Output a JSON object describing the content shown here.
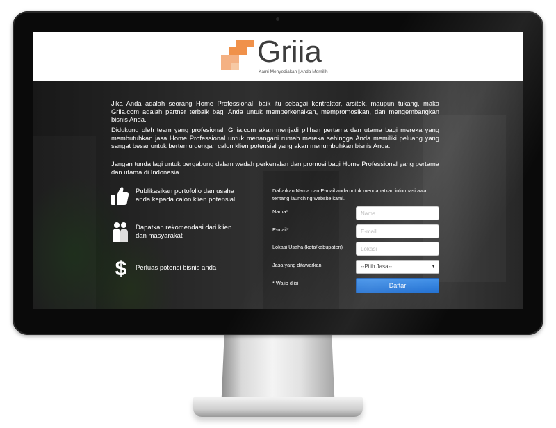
{
  "brand": {
    "name": "Griia",
    "tagline": "Kami Menyediakan | Anda Memilih",
    "logo_colors": [
      "#f0914a",
      "#f4b183"
    ]
  },
  "intro": {
    "paragraphs": [
      "Jika Anda adalah seorang Home Professional, baik itu sebagai kontraktor, arsitek, maupun tukang, maka Griia.com adalah partner terbaik bagi Anda untuk memperkenalkan, mempromosikan, dan mengembangkan bisnis Anda.",
      "Didukung oleh team yang profesional, Griia.com akan menjadi pilihan pertama dan utama bagi mereka yang membutuhkan jasa Home Professional untuk menangani rumah mereka sehingga Anda memiliki peluang yang sangat besar untuk bertemu dengan calon klien potensial yang akan menumbuhkan bisnis Anda.",
      "Jangan tunda lagi untuk bergabung dalam wadah perkenalan dan promosi bagi Home Professional yang pertama dan utama di Indonesia."
    ]
  },
  "features": [
    {
      "icon": "thumbs-up-icon",
      "text": "Publikasikan portofolio dan usaha anda kepada calon klien potensial"
    },
    {
      "icon": "people-icon",
      "text": "Dapatkan rekomendasi dari klien dan masyarakat"
    },
    {
      "icon": "dollar-icon",
      "text": "Perluas potensi bisnis anda"
    }
  ],
  "form": {
    "intro": "Daftarkan Nama dan E-mail anda untuk mendapatkan informasi awal tentang launching website kami.",
    "name_label": "Nama*",
    "name_placeholder": "Nama",
    "email_label": "E-mail*",
    "email_placeholder": "E-mail",
    "location_label": "Lokasi Usaha (kota/kabupaten)",
    "location_placeholder": "Lokasi",
    "service_label": "Jasa yang ditawarkan",
    "service_selected": "--Pilih Jasa--",
    "required_note": "* Wajib diisi",
    "submit_label": "Daftar",
    "button_color": "#2a7de1"
  }
}
